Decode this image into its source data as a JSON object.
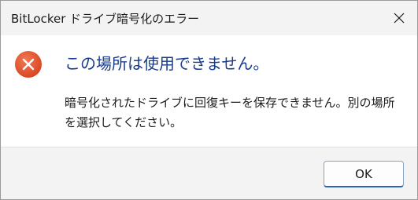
{
  "window": {
    "title": "BitLocker ドライブ暗号化のエラー",
    "close_icon": "close-icon"
  },
  "message": {
    "icon": "error-icon",
    "icon_color": "#e3532d",
    "main_instruction": "この場所は使用できません。",
    "main_instruction_color": "#1a3c8c",
    "body_line1": "暗号化されたドライブに回復キーを保存できません。別の場所",
    "body_line2": "を選択してください。"
  },
  "footer": {
    "ok_label": "OK",
    "accent_color": "#2a63b8"
  }
}
